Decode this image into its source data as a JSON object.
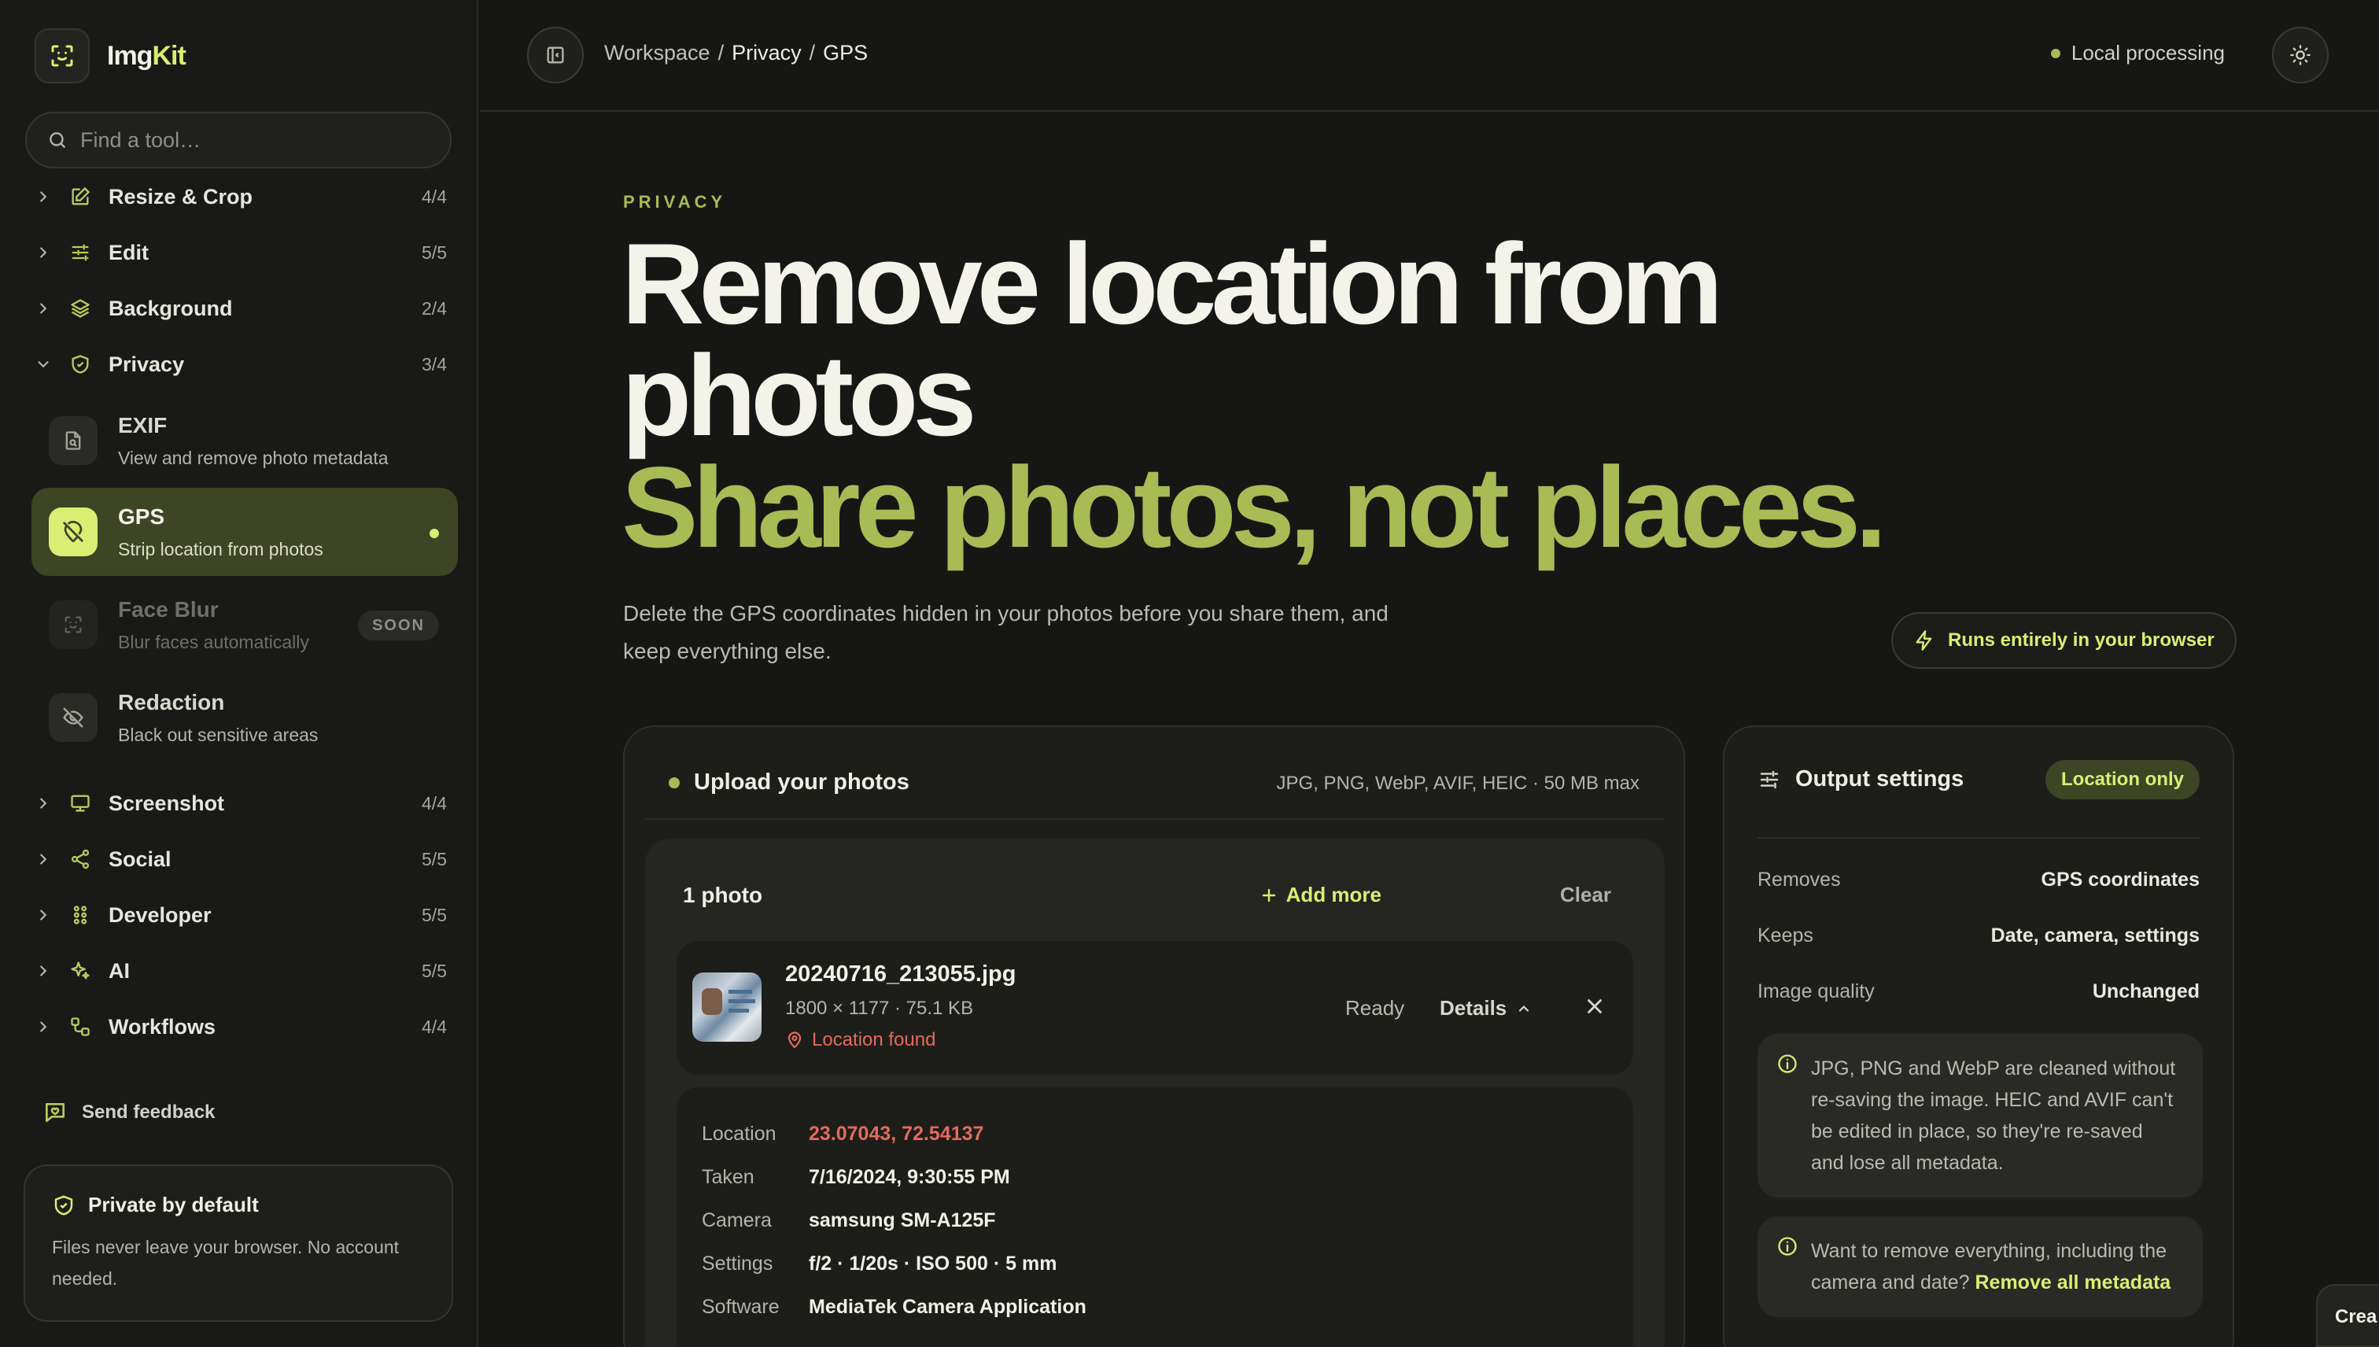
{
  "brand": {
    "name_main": "Img",
    "name_accent": "Kit"
  },
  "search": {
    "placeholder": "Find a tool…"
  },
  "sidebar": {
    "categories_top": [
      {
        "label": "Resize & Crop",
        "count": "4/4"
      },
      {
        "label": "Edit",
        "count": "5/5"
      },
      {
        "label": "Background",
        "count": "2/4"
      },
      {
        "label": "Privacy",
        "count": "3/4"
      }
    ],
    "privacy_tools": [
      {
        "title": "EXIF",
        "desc": "View and remove photo metadata"
      },
      {
        "title": "GPS",
        "desc": "Strip location from photos"
      },
      {
        "title": "Face Blur",
        "desc": "Blur faces automatically",
        "badge": "SOON"
      },
      {
        "title": "Redaction",
        "desc": "Black out sensitive areas"
      }
    ],
    "categories_bottom": [
      {
        "label": "Screenshot",
        "count": "4/4"
      },
      {
        "label": "Social",
        "count": "5/5"
      },
      {
        "label": "Developer",
        "count": "5/5"
      },
      {
        "label": "AI",
        "count": "5/5"
      },
      {
        "label": "Workflows",
        "count": "4/4"
      }
    ],
    "feedback": "Send feedback",
    "private_card": {
      "title": "Private by default",
      "text": "Files never leave your browser. No account needed."
    }
  },
  "topbar": {
    "crumb_workspace": "Workspace",
    "sep": "/",
    "crumb_privacy": "Privacy",
    "crumb_gps": "GPS",
    "status": "Local processing"
  },
  "hero": {
    "eyebrow": "PRIVACY",
    "title": "Remove location from photos",
    "subtitle": "Share photos, not places.",
    "description": "Delete the GPS coordinates hidden in your photos before you share them, and keep everything else.",
    "browser_pill": "Runs entirely in your browser"
  },
  "upload": {
    "title": "Upload your photos",
    "formats": "JPG, PNG, WebP, AVIF, HEIC · 50 MB max",
    "count": "1 photo",
    "add_more": "Add more",
    "clear": "Clear",
    "file": {
      "name": "20240716_213055.jpg",
      "meta": "1800 × 1177 · 75.1 KB",
      "location_flag": "Location found",
      "status": "Ready",
      "details": "Details"
    },
    "details": [
      {
        "key": "Location",
        "value": "23.07043, 72.54137"
      },
      {
        "key": "Taken",
        "value": "7/16/2024, 9:30:55 PM"
      },
      {
        "key": "Camera",
        "value": "samsung SM-A125F"
      },
      {
        "key": "Settings",
        "value": "f/2 · 1/20s · ISO 500 · 5 mm"
      },
      {
        "key": "Software",
        "value": "MediaTek Camera Application"
      }
    ]
  },
  "output": {
    "title": "Output settings",
    "badge": "Location only",
    "rows": [
      {
        "key": "Removes",
        "value": "GPS coordinates"
      },
      {
        "key": "Keeps",
        "value": "Date, camera, settings"
      },
      {
        "key": "Image quality",
        "value": "Unchanged"
      }
    ],
    "note1": "JPG, PNG and WebP are cleaned without re-saving the image. HEIC and AVIF can't be edited in place, so they're re-saved and lose all metadata.",
    "note2_text": "Want to remove everything, including the camera and date?",
    "note2_link": "Remove all metadata"
  },
  "create_chip": "Crea",
  "colors": {
    "accent": "#d9ee73",
    "accent_dim": "#a8bb55",
    "warning": "#e36a5c",
    "background": "#161714"
  }
}
